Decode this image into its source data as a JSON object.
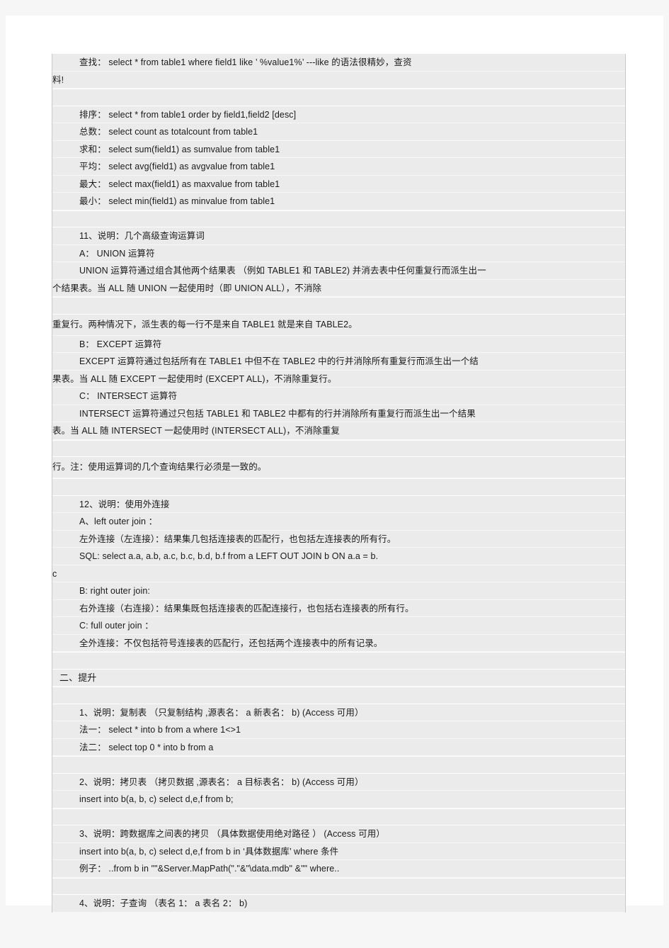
{
  "document": {
    "type": "sql-reference-notes",
    "language": "zh-CN",
    "page_background": "#f6f6f6",
    "sheet_background": "#ffffff",
    "block_background": "#ebebeb",
    "lines": [
      {
        "id": "l01",
        "text": "查找：  select       *     from     table1      where     field1       like       ’  %value1%’      ---like      的语法很精妙，查资",
        "style": "indent"
      },
      {
        "id": "l02",
        "text": "料!",
        "style": "flush"
      },
      {
        "id": "l03",
        "text": "",
        "style": "blank"
      },
      {
        "id": "l04",
        "text": "排序：  select       *     from     table1      order      by    field1,field2          [desc]",
        "style": "indent"
      },
      {
        "id": "l05",
        "text": "总数：  select       count     as     totalcount         from      table1",
        "style": "indent"
      },
      {
        "id": "l06",
        "text": "求和：  select       sum(field1)       as     sumvalue      from      table1",
        "style": "indent"
      },
      {
        "id": "l07",
        "text": "平均：  select       avg(field1)       as     avgvalue      from      table1",
        "style": "indent"
      },
      {
        "id": "l08",
        "text": "最大：  select       max(field1)       as     maxvalue      from      table1",
        "style": "indent"
      },
      {
        "id": "l09",
        "text": "最小：  select       min(field1)       as     minvalue      from      table1",
        "style": "indent"
      },
      {
        "id": "l10",
        "text": "",
        "style": "blank"
      },
      {
        "id": "l11",
        "text": "11、说明：几个高级查询运算词",
        "style": "indent"
      },
      {
        "id": "l12",
        "text": "A：    UNION   运算符",
        "style": "indent"
      },
      {
        "id": "l13",
        "text": "UNION   运算符通过组合其他两个结果表       （例如    TABLE1  和    TABLE2) 并消去表中任何重复行而派生出一",
        "style": "indent"
      },
      {
        "id": "l14",
        "text": "个结果表。当      ALL   随   UNION   一起使用时（即       UNION   ALL），不消除",
        "style": "flush"
      },
      {
        "id": "l15",
        "text": "",
        "style": "blank"
      },
      {
        "id": "l16",
        "text": "重复行。两种情况下，派生表的每一行不是来自               TABLE1   就是来自      TABLE2。",
        "style": "flush-pad"
      },
      {
        "id": "l17",
        "text": "B：    EXCEPT  运算符",
        "style": "indent"
      },
      {
        "id": "l18",
        "text": "EXCEPT  运算符通过包括所有在          TABLE1   中但不在     TABLE2   中的行并消除所有重复行而派生出一个结",
        "style": "indent"
      },
      {
        "id": "l19",
        "text": "果表。当     ALL    随    EXCEPT   一起使用时      (EXCEPT   ALL)，不消除重复行。",
        "style": "flush"
      },
      {
        "id": "l20",
        "text": "C：    INTERSECT   运算符",
        "style": "indent"
      },
      {
        "id": "l21",
        "text": "INTERSECT   运算符通过只包括        TABLE1   和    TABLE2   中都有的行并消除所有重复行而派生出一个结果",
        "style": "indent"
      },
      {
        "id": "l22",
        "text": "表。当    ALL    随    INTERSECT  一起使用时        (INTERSECT   ALL)，不消除重复",
        "style": "flush"
      },
      {
        "id": "l23",
        "text": "",
        "style": "blank"
      },
      {
        "id": "l24",
        "text": "行。注：使用运算词的几个查询结果行必须是一致的。",
        "style": "flush-pad"
      },
      {
        "id": "l25",
        "text": "",
        "style": "blank"
      },
      {
        "id": "l26",
        "text": "12、说明：使用外连接",
        "style": "indent"
      },
      {
        "id": "l27",
        "text": "A、left      outer     join  ：",
        "style": "indent"
      },
      {
        "id": "l28",
        "text": "左外连接（左连接）：结果集几包括连接表的匹配行，也包括左连接表的所有行。",
        "style": "indent"
      },
      {
        "id": "l29",
        "text": "SQL:  select      a.a,      a.b,      a.c,     b.c,     b.d,     b.f   from    a   LEFT   OUT  JOIN   b   ON  a.a    =   b.",
        "style": "indent"
      },
      {
        "id": "l30",
        "text": "c",
        "style": "flush"
      },
      {
        "id": "l31",
        "text": "B: right      outer     join:",
        "style": "indent"
      },
      {
        "id": "l32",
        "text": "右外连接（右连接）：结果集既包括连接表的匹配连接行，也包括右连接表的所有行。",
        "style": "indent"
      },
      {
        "id": "l33",
        "text": "C: full       outer      join  ：",
        "style": "indent"
      },
      {
        "id": "l34",
        "text": "全外连接：不仅包括符号连接表的匹配行，还包括两个连接表中的所有记录。",
        "style": "indent"
      },
      {
        "id": "l35",
        "text": "",
        "style": "blank"
      },
      {
        "id": "l36",
        "text": "二、提升",
        "style": "heading"
      },
      {
        "id": "l37",
        "text": "",
        "style": "blank"
      },
      {
        "id": "l38",
        "text": "1、说明：复制表   （只复制结构 ,源表名： a   新表名： b)   (Access  可用）",
        "style": "indent"
      },
      {
        "id": "l39",
        "text": "法一： select      *    into     b   from    a   where    1<>1",
        "style": "indent"
      },
      {
        "id": "l40",
        "text": "法二： select      top   0  *    into     b   from    a",
        "style": "indent"
      },
      {
        "id": "l41",
        "text": "",
        "style": "blank"
      },
      {
        "id": "l42",
        "text": "2、说明：拷贝表   （拷贝数据 ,源表名： a   目标表名： b)   (Access  可用）",
        "style": "indent"
      },
      {
        "id": "l43",
        "text": "insert      into      b(a,     b,    c)   select      d,e,f     from     b;",
        "style": "indent"
      },
      {
        "id": "l44",
        "text": "",
        "style": "blank"
      },
      {
        "id": "l45",
        "text": "3、说明：跨数据库之间表的拷贝      （具体数据使用绝对路径     ）   (Access  可用）",
        "style": "indent"
      },
      {
        "id": "l46",
        "text": "insert      into      b(a,     b,    c)   select      d,e,f     from     b   in   ‘具体数据库’         where    条件",
        "style": "indent"
      },
      {
        "id": "l47",
        "text": "例子： ..from      b    in    \"\"&Server.MapPath(\".\"&\"\\data.mdb\"            &\"\"    where..",
        "style": "indent"
      },
      {
        "id": "l48",
        "text": "",
        "style": "blank"
      },
      {
        "id": "l49",
        "text": "4、说明：子查询   （表名 1： a   表名 2： b)",
        "style": "indent"
      }
    ]
  }
}
